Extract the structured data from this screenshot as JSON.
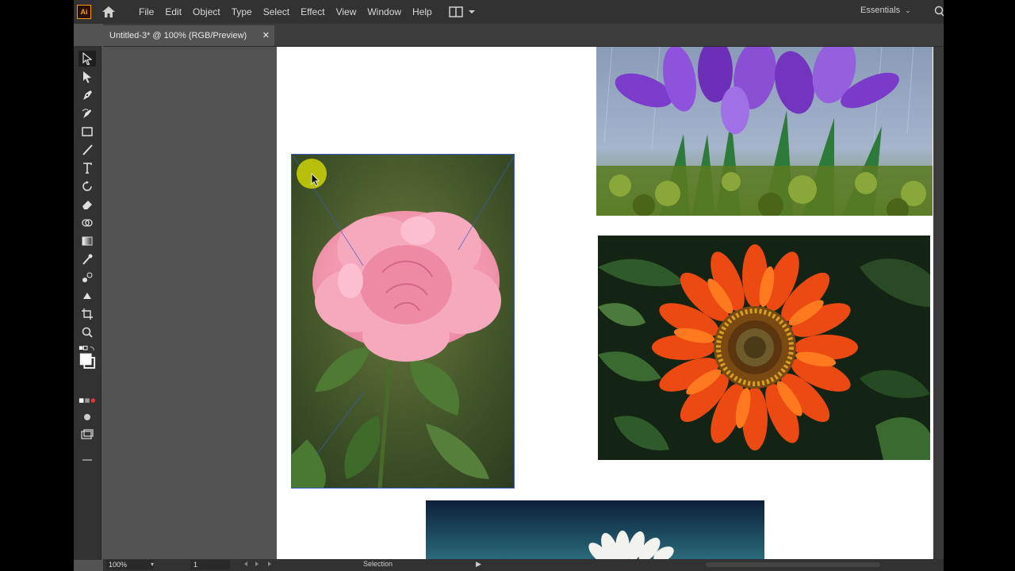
{
  "app": {
    "logo_text": "Ai",
    "accent": "#ff9a00"
  },
  "menu": {
    "items": [
      "File",
      "Edit",
      "Object",
      "Type",
      "Select",
      "Effect",
      "View",
      "Window",
      "Help"
    ]
  },
  "workspace": {
    "label": "Essentials"
  },
  "document": {
    "tab_title": "Untitled-3* @ 100% (RGB/Preview)",
    "close_glyph": "✕"
  },
  "tools": [
    "selection-tool-icon",
    "direct-selection-tool-icon",
    "pen-tool-icon",
    "curvature-tool-icon",
    "rectangle-tool-icon",
    "paintbrush-tool-icon",
    "type-tool-icon",
    "rotate-tool-icon",
    "eraser-tool-icon",
    "shape-builder-tool-icon",
    "gradient-tool-icon",
    "eyedropper-tool-icon",
    "blend-tool-icon",
    "live-paint-tool-icon",
    "artboard-tool-icon",
    "zoom-tool-icon"
  ],
  "images": [
    {
      "name": "rose-photo",
      "subject": "pink rose"
    },
    {
      "name": "crocus-photo",
      "subject": "purple crocus flowers"
    },
    {
      "name": "gazania-photo",
      "subject": "orange gazania flower"
    },
    {
      "name": "daisy-photo",
      "subject": "white daisy on blue background"
    }
  ],
  "status": {
    "zoom": "100%",
    "page": "1",
    "text": "Selection"
  },
  "colors": {
    "menubar": "#323232",
    "canvas": "#535353",
    "artboard": "#ffffff",
    "selection": "#3a5bc7"
  }
}
